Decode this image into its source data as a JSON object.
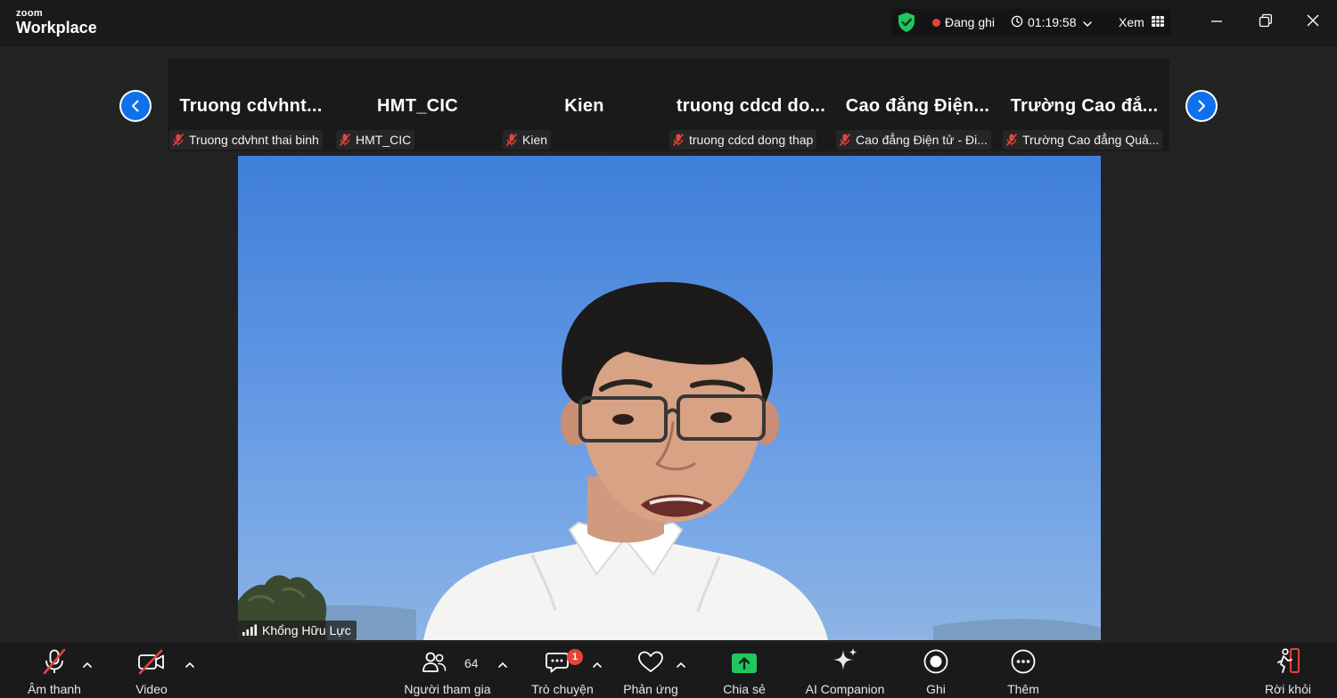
{
  "app": {
    "logo_top": "zoom",
    "logo_bottom": "Workplace"
  },
  "status": {
    "recording_label": "Đang ghi",
    "timer": "01:19:58",
    "view_label": "Xem"
  },
  "gallery": {
    "tiles": [
      {
        "name": "Truong  cdvhnt...",
        "label": "Truong cdvhnt thai binh"
      },
      {
        "name": "HMT_CIC",
        "label": "HMT_CIC"
      },
      {
        "name": "Kien",
        "label": "Kien"
      },
      {
        "name": "truong  cdcd  do...",
        "label": "truong cdcd dong thap"
      },
      {
        "name": "Cao  đẳng  Điện...",
        "label": "Cao đẳng Điện tử - Đi..."
      },
      {
        "name": "Trường  Cao  đẳ...",
        "label": "Trường Cao đẳng Quả..."
      }
    ]
  },
  "speaker": {
    "name": "Khổng Hữu Lực"
  },
  "toolbar": {
    "audio": "Âm thanh",
    "video": "Video",
    "participants": "Người tham gia",
    "participants_count": "64",
    "chat": "Trò chuyện",
    "chat_badge": "1",
    "reactions": "Phản ứng",
    "share": "Chia sẻ",
    "ai": "AI Companion",
    "record": "Ghi",
    "more": "Thêm",
    "leave": "Rời khỏi"
  },
  "colors": {
    "accent": "#0e71eb",
    "share_green": "#23c55e",
    "mute_red": "#e5443b",
    "shield_green": "#23c55e"
  }
}
